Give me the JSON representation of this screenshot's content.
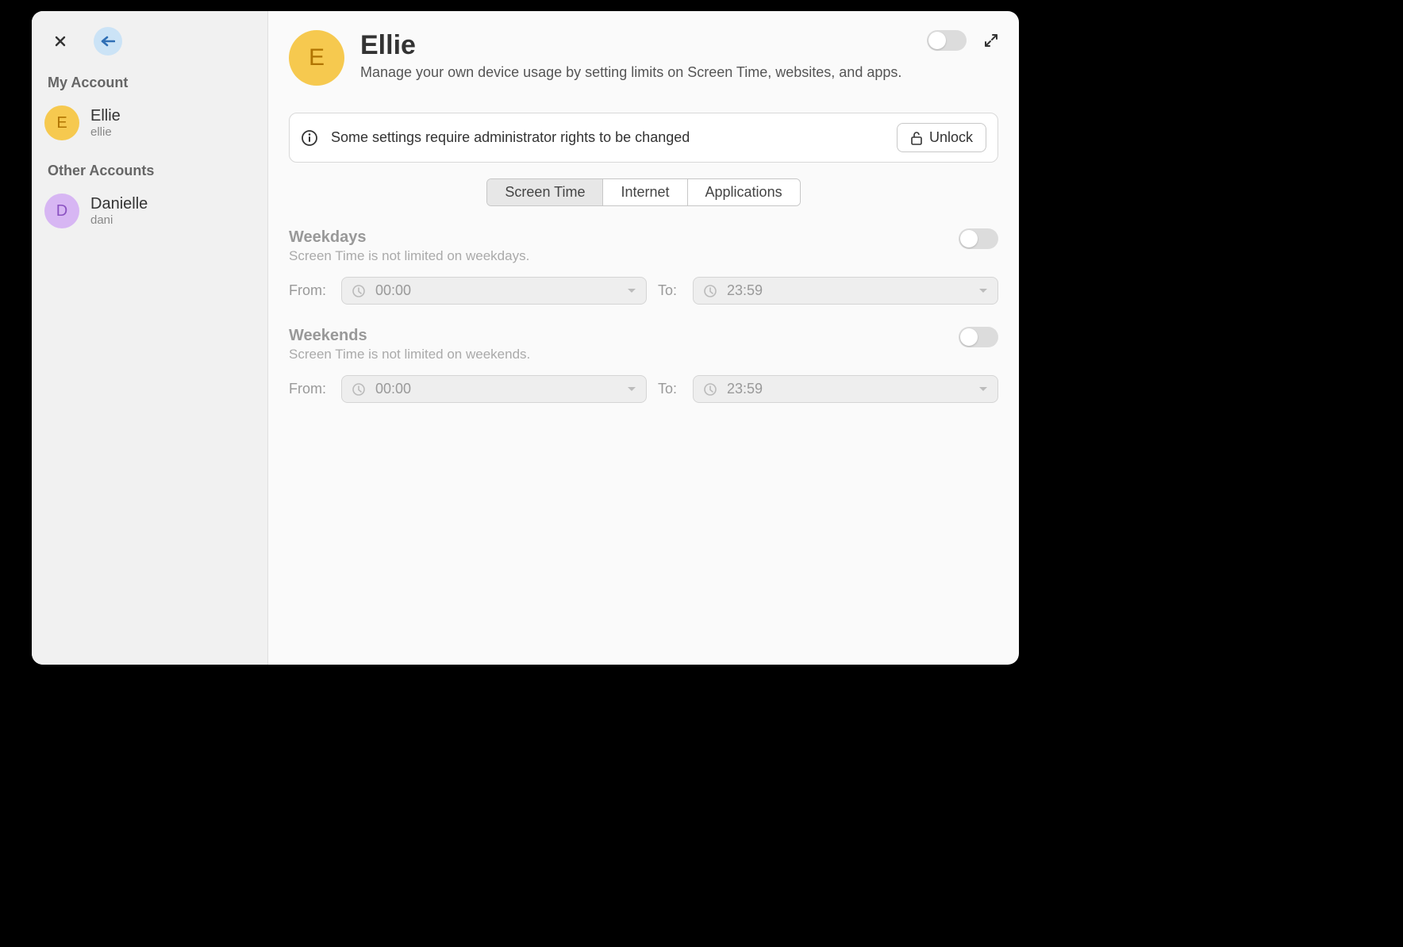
{
  "sidebar": {
    "sections": {
      "my_account": "My Account",
      "other_accounts": "Other Accounts"
    },
    "accounts": [
      {
        "initial": "E",
        "name": "Ellie",
        "username": "ellie",
        "avatar_class": "e"
      },
      {
        "initial": "D",
        "name": "Danielle",
        "username": "dani",
        "avatar_class": "d"
      }
    ]
  },
  "header": {
    "avatar_initial": "E",
    "title": "Ellie",
    "subtitle": "Manage your own device usage by setting limits on Screen Time, websites, and apps."
  },
  "admin_banner": {
    "message": "Some settings require administrator rights to be changed",
    "unlock_label": "Unlock"
  },
  "tabs": [
    {
      "label": "Screen Time",
      "active": true
    },
    {
      "label": "Internet",
      "active": false
    },
    {
      "label": "Applications",
      "active": false
    }
  ],
  "limits": [
    {
      "title": "Weekdays",
      "sub": "Screen Time is not limited on weekdays.",
      "from_label": "From:",
      "from_value": "00:00",
      "to_label": "To:",
      "to_value": "23:59"
    },
    {
      "title": "Weekends",
      "sub": "Screen Time is not limited on weekends.",
      "from_label": "From:",
      "from_value": "00:00",
      "to_label": "To:",
      "to_value": "23:59"
    }
  ]
}
